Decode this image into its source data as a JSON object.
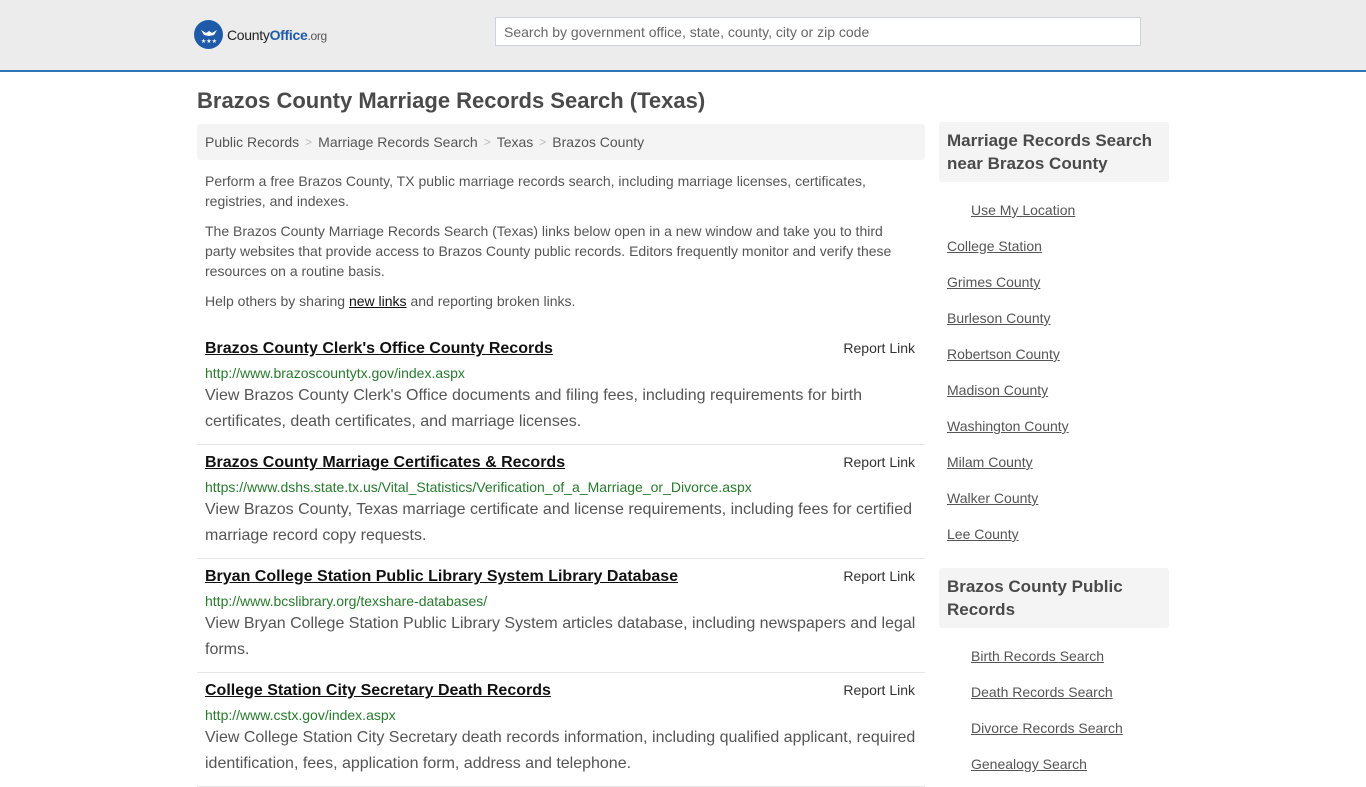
{
  "header": {
    "logo": {
      "county": "County",
      "office": "Office",
      "org": ".org"
    },
    "search_placeholder": "Search by government office, state, county, city or zip code",
    "accent_color": "#2f74b5"
  },
  "page_title": "Brazos County Marriage Records Search (Texas)",
  "breadcrumb": [
    "Public Records",
    "Marriage Records Search",
    "Texas",
    "Brazos County"
  ],
  "intro": {
    "p1": "Perform a free Brazos County, TX public marriage records search, including marriage licenses, certificates, registries, and indexes.",
    "p2": "The Brazos County Marriage Records Search (Texas) links below open in a new window and take you to third party websites that provide access to Brazos County public records. Editors frequently monitor and verify these resources on a routine basis.",
    "p3_before": "Help others by sharing ",
    "p3_link": "new links",
    "p3_after": " and reporting broken links."
  },
  "results": [
    {
      "title": "Brazos County Clerk's Office County Records",
      "url": "http://www.brazoscountytx.gov/index.aspx",
      "description": "View Brazos County Clerk's Office documents and filing fees, including requirements for birth certificates, death certificates, and marriage licenses.",
      "report_label": "Report Link"
    },
    {
      "title": "Brazos County Marriage Certificates & Records",
      "url": "https://www.dshs.state.tx.us/Vital_Statistics/Verification_of_a_Marriage_or_Divorce.aspx",
      "description": "View Brazos County, Texas marriage certificate and license requirements, including fees for certified marriage record copy requests.",
      "report_label": "Report Link"
    },
    {
      "title": "Bryan College Station Public Library System Library Database",
      "url": "http://www.bcslibrary.org/texshare-databases/",
      "description": "View Bryan College Station Public Library System articles database, including newspapers and legal forms.",
      "report_label": "Report Link"
    },
    {
      "title": "College Station City Secretary Death Records",
      "url": "http://www.cstx.gov/index.aspx",
      "description": "View College Station City Secretary death records information, including qualified applicant, required identification, fees, application form, address and telephone.",
      "report_label": "Report Link"
    }
  ],
  "sidebar": {
    "nearby": {
      "heading": "Marriage Records Search near Brazos County",
      "use_location": "Use My Location",
      "items": [
        "College Station",
        "Grimes County",
        "Burleson County",
        "Robertson County",
        "Madison County",
        "Washington County",
        "Milam County",
        "Walker County",
        "Lee County"
      ]
    },
    "public_records": {
      "heading": "Brazos County Public Records",
      "items": [
        "Birth Records Search",
        "Death Records Search",
        "Divorce Records Search",
        "Genealogy Search"
      ]
    }
  }
}
